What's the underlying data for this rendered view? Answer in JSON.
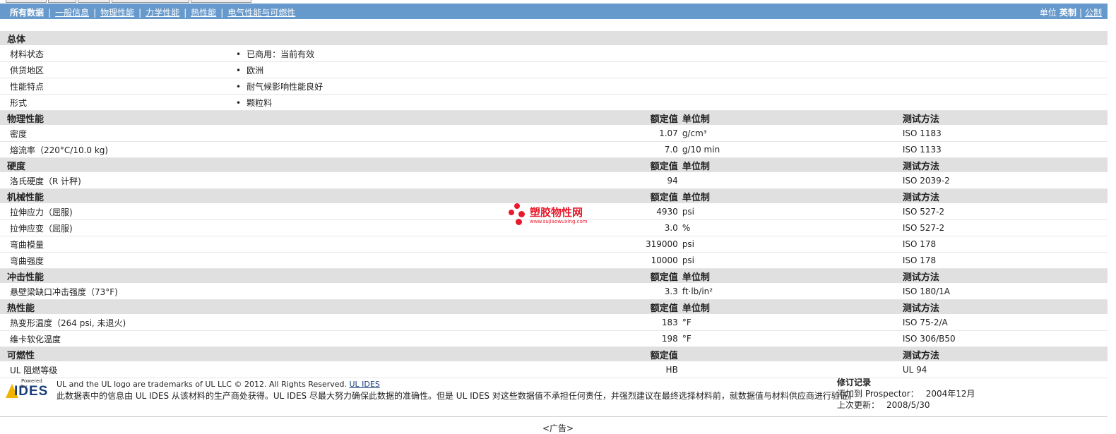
{
  "nav": {
    "current": "所有数据",
    "links": [
      "一般信息",
      "物理性能",
      "力学性能",
      "热性能",
      "电气性能与可燃性"
    ]
  },
  "units": {
    "label": "单位",
    "selected": "英制",
    "other": "公制"
  },
  "sections": [
    {
      "title": "总体",
      "col_value": "",
      "col_unit": "",
      "col_method": "",
      "rows": [
        {
          "name": "材料状态",
          "bullet": "已商用：当前有效"
        },
        {
          "name": "供货地区",
          "bullet": "欧洲"
        },
        {
          "name": "性能特点",
          "bullet": "耐气候影响性能良好"
        },
        {
          "name": "形式",
          "bullet": "颗粒料"
        }
      ]
    },
    {
      "title": "物理性能",
      "col_value": "额定值",
      "col_unit": "单位制",
      "col_method": "测试方法",
      "rows": [
        {
          "name": "密度",
          "value": "1.07",
          "unit": "g/cm³",
          "method": "ISO 1183"
        },
        {
          "name": "熔流率（220°C/10.0 kg)",
          "value": "7.0",
          "unit": "g/10 min",
          "method": "ISO 1133"
        }
      ]
    },
    {
      "title": "硬度",
      "col_value": "额定值",
      "col_unit": "单位制",
      "col_method": "测试方法",
      "rows": [
        {
          "name": "洛氏硬度（R 计秤)",
          "value": "94",
          "unit": "",
          "method": "ISO 2039-2"
        }
      ]
    },
    {
      "title": "机械性能",
      "col_value": "额定值",
      "col_unit": "单位制",
      "col_method": "测试方法",
      "rows": [
        {
          "name": "拉伸应力（屈服)",
          "value": "4930",
          "unit": "psi",
          "method": "ISO 527-2"
        },
        {
          "name": "拉伸应变（屈服)",
          "value": "3.0",
          "unit": "%",
          "method": "ISO 527-2"
        },
        {
          "name": "弯曲模量",
          "value": "319000",
          "unit": "psi",
          "method": "ISO 178"
        },
        {
          "name": "弯曲强度",
          "value": "10000",
          "unit": "psi",
          "method": "ISO 178"
        }
      ]
    },
    {
      "title": "冲击性能",
      "col_value": "额定值",
      "col_unit": "单位制",
      "col_method": "测试方法",
      "rows": [
        {
          "name": "悬壁梁缺口冲击强度（73°F)",
          "value": "3.3",
          "unit": "ft·lb/in²",
          "method": "ISO 180/1A"
        }
      ]
    },
    {
      "title": "热性能",
      "col_value": "额定值",
      "col_unit": "单位制",
      "col_method": "测试方法",
      "rows": [
        {
          "name": "热变形温度（264 psi, 未退火)",
          "value": "183",
          "unit": "°F",
          "method": "ISO 75-2/A"
        },
        {
          "name": "维卡软化温度",
          "value": "198",
          "unit": "°F",
          "method": "ISO 306/B50"
        }
      ]
    },
    {
      "title": "可燃性",
      "col_value": "额定值",
      "col_unit": "",
      "col_method": "测试方法",
      "rows": [
        {
          "name": "UL 阻燃等级",
          "value": "HB",
          "unit": "",
          "method": "UL 94"
        }
      ]
    }
  ],
  "watermark": {
    "name": "塑胶物性网",
    "url": "www.sujiaowuxing.com",
    "color": "#e8192c"
  },
  "footer": {
    "logo_top": "Powered by",
    "logo_text": "IDES",
    "legal": "UL and the UL logo are trademarks of UL LLC © 2012. All Rights Reserved.",
    "legal_link": "UL IDES",
    "disclaimer": "此数据表中的信息由  UL IDES 从该材料的生产商处获得。UL IDES 尽最大努力确保此数据的准确性。但是  UL IDES 对这些数据值不承担任何责任，并强烈建议在最终选择材料前，就数据值与材料供应商进行验证。",
    "revision_title": "修订记录",
    "added_label": "添加到  Prospector：",
    "added_value": "2004年12月",
    "updated_label": "上次更新：",
    "updated_value": "2008/5/30"
  },
  "ad_label": "<广告>",
  "colors": {
    "nav_bg": "#6699cc",
    "section_bg": "#e0e0e0"
  }
}
